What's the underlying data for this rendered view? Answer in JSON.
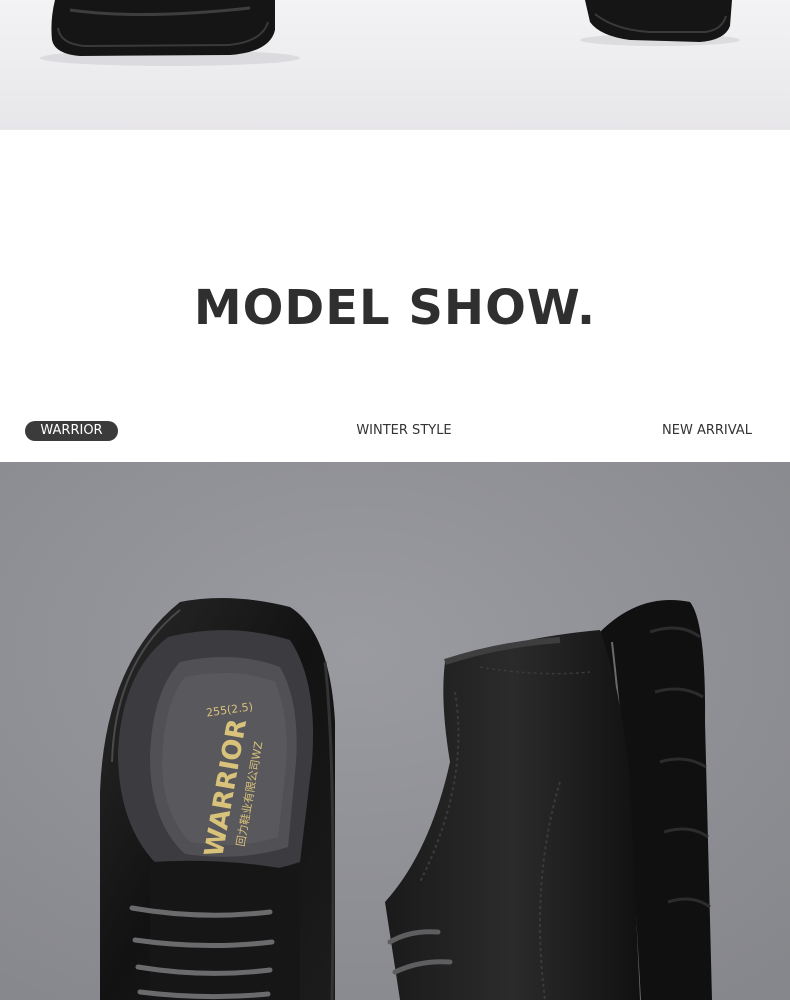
{
  "heading": {
    "text": "MODEL SHOW."
  },
  "tags": {
    "left": "WARRIOR",
    "middle": "WINTER STYLE",
    "right": "NEW ARRIVAL"
  },
  "insole": {
    "brand": "WARRIOR",
    "size": "255(2.5)",
    "company": "回力鞋业有限公司WZ"
  },
  "colors": {
    "top_background": "#ecebed",
    "bottom_background": "#8e8f94",
    "title": "#2f2f2f",
    "pill": "#3b3b3b",
    "leather": "#141414"
  }
}
